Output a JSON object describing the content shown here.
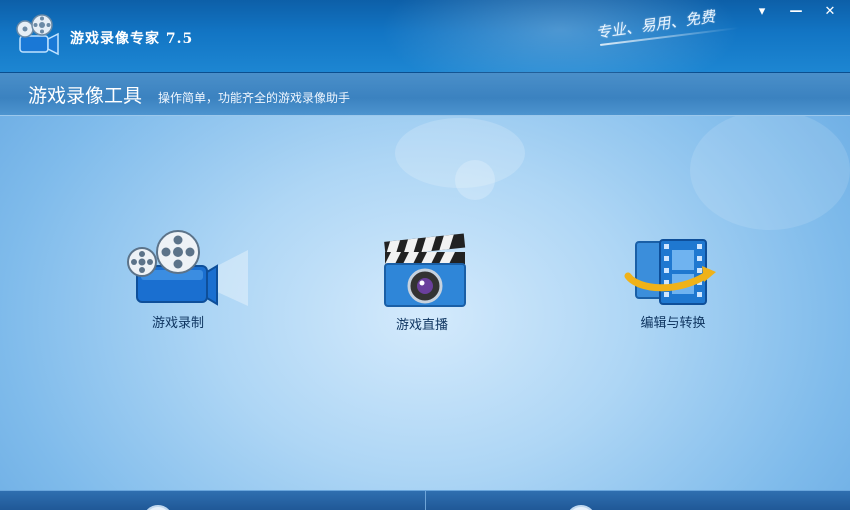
{
  "window": {
    "title": "游戏录像专家 7.5",
    "slogan": "专业、易用、免费",
    "controls": {
      "menu": "▾",
      "minimize": "—",
      "close": "✕"
    }
  },
  "header": {
    "title": "游戏录像工具",
    "description": "操作简单，功能齐全的游戏录像助手"
  },
  "features": [
    {
      "label": "游戏录制",
      "icon": "film-camera-icon"
    },
    {
      "label": "游戏直播",
      "icon": "clapperboard-camera-icon"
    },
    {
      "label": "编辑与转换",
      "icon": "film-convert-icon"
    }
  ],
  "colors": {
    "titlebar": "#1275c4",
    "subbar": "#3b82c0",
    "accent": "#1d86d2",
    "label_text": "#0f3560"
  }
}
